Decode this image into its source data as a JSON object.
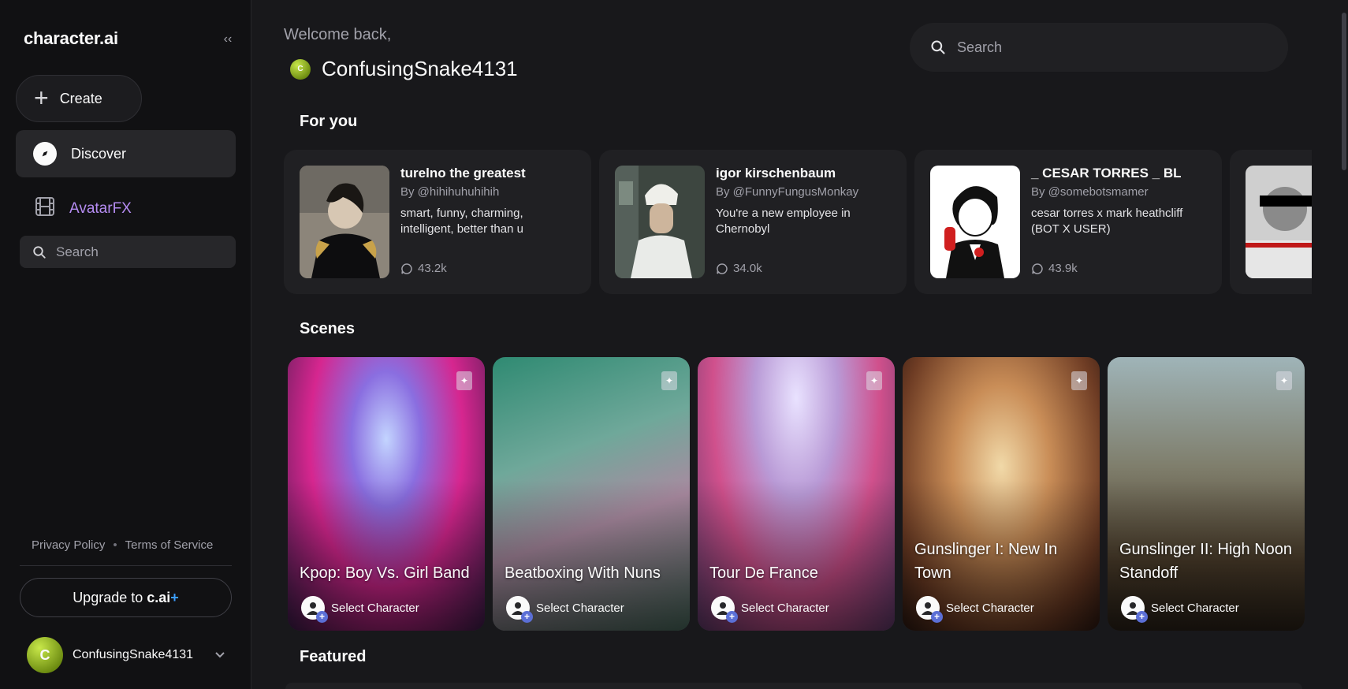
{
  "sidebar": {
    "logo": "character.ai",
    "create_label": "Create",
    "discover_label": "Discover",
    "avatarfx_label": "AvatarFX",
    "search_placeholder": "Search",
    "privacy_label": "Privacy Policy",
    "dot": "•",
    "terms_label": "Terms of Service",
    "upgrade_prefix": "Upgrade to ",
    "upgrade_brand": "c.ai",
    "upgrade_plus": "+",
    "user_initial": "C",
    "user_name": "ConfusingSnake4131"
  },
  "main": {
    "welcome": "Welcome back,",
    "user_initial": "C",
    "user_name": "ConfusingSnake4131",
    "search_placeholder": "Search"
  },
  "sections": {
    "for_you": "For you",
    "scenes": "Scenes",
    "featured": "Featured"
  },
  "for_you": [
    {
      "name": "turelno the greatest",
      "author": "By @hihihuhuhihih",
      "desc": "smart, funny, charming, intelligent, better than u",
      "count": "43.2k"
    },
    {
      "name": "igor kirschenbaum",
      "author": "By @FunnyFungusMonkay",
      "desc": "You're a new employee in Chernobyl",
      "count": "34.0k"
    },
    {
      "name": "_ CESAR TORRES _ BL",
      "author": "By @somebotsmamer",
      "desc": "cesar torres x mark heathcliff (BOT X USER)",
      "count": "43.9k"
    },
    {
      "name": "",
      "author": "",
      "desc": "",
      "count": ""
    }
  ],
  "scenes": [
    {
      "title": "Kpop: Boy Vs. Girl Band",
      "select": "Select Character"
    },
    {
      "title": "Beatboxing With Nuns",
      "select": "Select Character"
    },
    {
      "title": "Tour De France",
      "select": "Select Character"
    },
    {
      "title": "Gunslinger I: New In Town",
      "select": "Select Character"
    },
    {
      "title": "Gunslinger II: High Noon Standoff",
      "select": "Select Character"
    }
  ],
  "colors": {
    "accent_purple": "#b58cf2",
    "upgrade_plus": "#3b9dff",
    "background": "#18181b",
    "sidebar": "#111113",
    "card": "#202023"
  },
  "icons": [
    "collapse-icon",
    "plus-icon",
    "compass-icon",
    "film-icon",
    "search-icon",
    "chat-bubble-icon",
    "scene-badge-icon",
    "user-add-icon",
    "chevron-down-icon"
  ]
}
